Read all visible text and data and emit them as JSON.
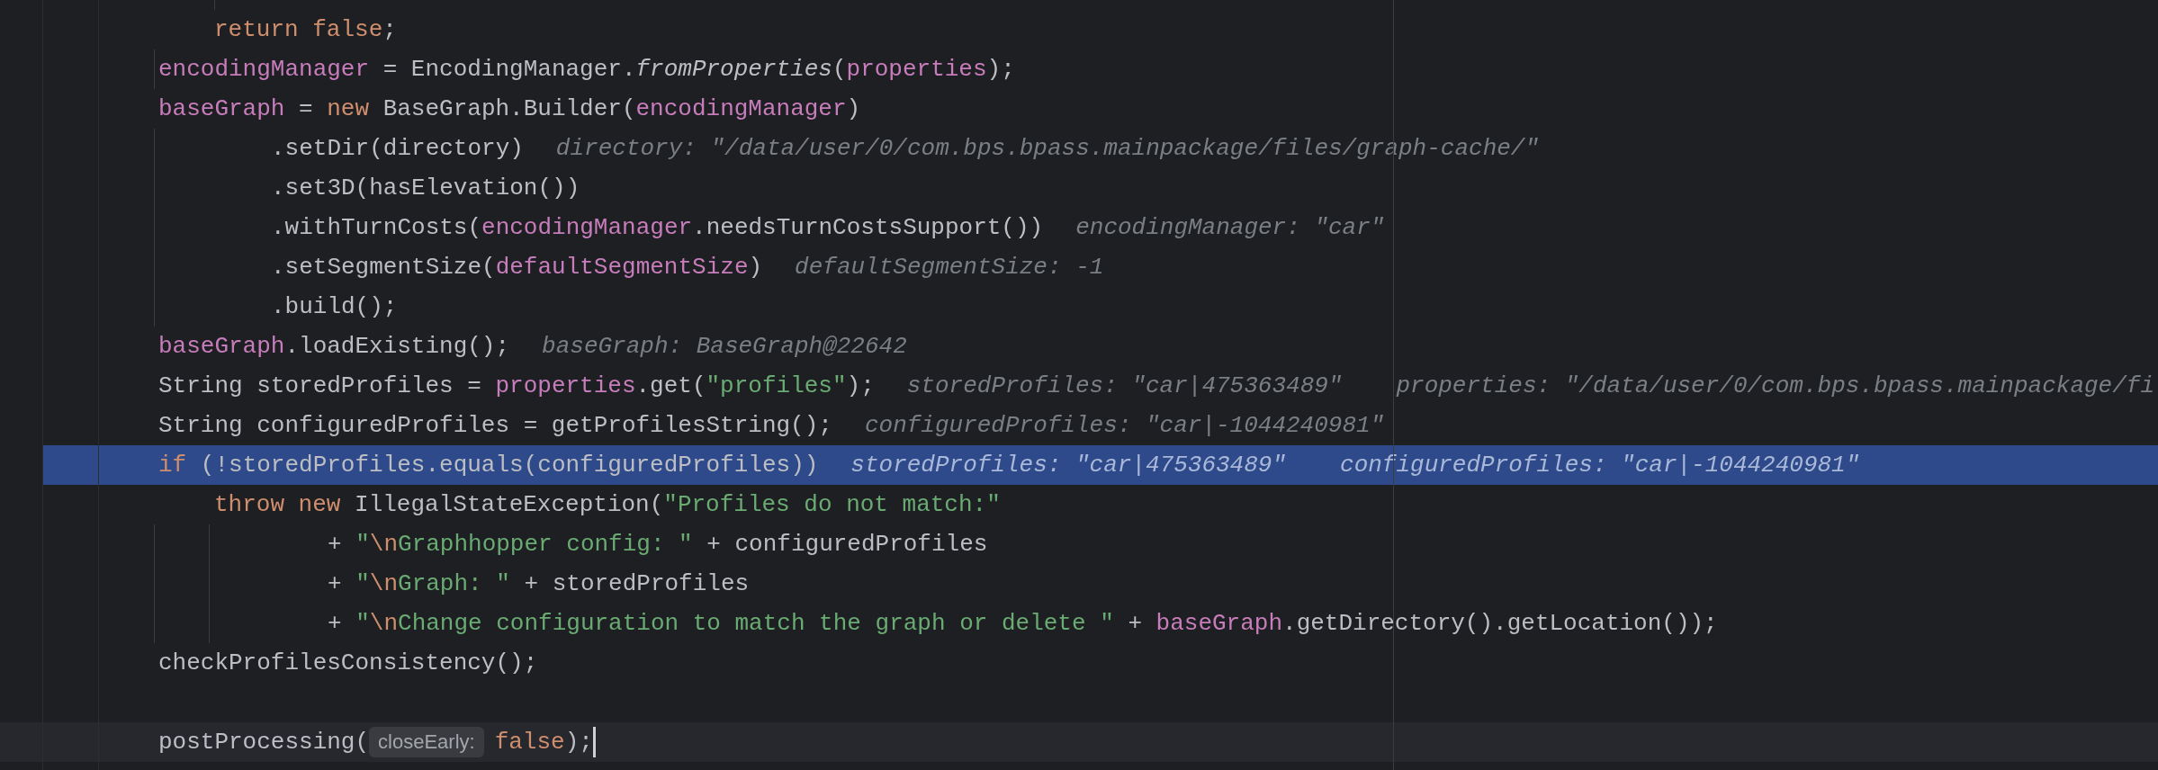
{
  "editor": {
    "lines": [
      {
        "kind": "inner",
        "highlighted": false,
        "caret": false,
        "tokens": [
          {
            "kind": "keyword",
            "text": "return "
          },
          {
            "kind": "keyword",
            "text": "false"
          },
          {
            "kind": "plain",
            "text": ";"
          }
        ]
      },
      {
        "kind": "block",
        "highlighted": false,
        "caret": false,
        "tokens": [
          {
            "kind": "field",
            "text": "encodingManager"
          },
          {
            "kind": "plain",
            "text": " = EncodingManager."
          },
          {
            "kind": "static",
            "text": "fromProperties"
          },
          {
            "kind": "plain",
            "text": "("
          },
          {
            "kind": "field",
            "text": "properties"
          },
          {
            "kind": "plain",
            "text": ");"
          }
        ]
      },
      {
        "kind": "block",
        "highlighted": false,
        "caret": false,
        "tokens": [
          {
            "kind": "field",
            "text": "baseGraph"
          },
          {
            "kind": "plain",
            "text": " = "
          },
          {
            "kind": "keyword",
            "text": "new"
          },
          {
            "kind": "plain",
            "text": " BaseGraph.Builder("
          },
          {
            "kind": "field",
            "text": "encodingManager"
          },
          {
            "kind": "plain",
            "text": ")"
          }
        ]
      },
      {
        "kind": "chained",
        "highlighted": false,
        "caret": false,
        "tokens": [
          {
            "kind": "plain",
            "text": ".setDir(directory)"
          }
        ],
        "hints": [
          "directory: \"/data/user/0/com.bps.bpass.mainpackage/files/graph-cache/\""
        ]
      },
      {
        "kind": "chained",
        "highlighted": false,
        "caret": false,
        "tokens": [
          {
            "kind": "plain",
            "text": ".set3D(hasElevation())"
          }
        ]
      },
      {
        "kind": "chained",
        "highlighted": false,
        "caret": false,
        "tokens": [
          {
            "kind": "plain",
            "text": ".withTurnCosts("
          },
          {
            "kind": "field",
            "text": "encodingManager"
          },
          {
            "kind": "plain",
            "text": ".needsTurnCostsSupport())"
          }
        ],
        "hints": [
          "encodingManager: \"car\""
        ]
      },
      {
        "kind": "chained",
        "highlighted": false,
        "caret": false,
        "tokens": [
          {
            "kind": "plain",
            "text": ".setSegmentSize("
          },
          {
            "kind": "field",
            "text": "defaultSegmentSize"
          },
          {
            "kind": "plain",
            "text": ")"
          }
        ],
        "hints": [
          "defaultSegmentSize: -1"
        ]
      },
      {
        "kind": "chained",
        "highlighted": false,
        "caret": false,
        "tokens": [
          {
            "kind": "plain",
            "text": ".build();"
          }
        ]
      },
      {
        "kind": "block",
        "highlighted": false,
        "caret": false,
        "tokens": [
          {
            "kind": "field",
            "text": "baseGraph"
          },
          {
            "kind": "plain",
            "text": ".loadExisting();"
          }
        ],
        "hints": [
          "baseGraph: BaseGraph@22642"
        ]
      },
      {
        "kind": "block",
        "highlighted": false,
        "caret": false,
        "tokens": [
          {
            "kind": "plain",
            "text": "String storedProfiles = "
          },
          {
            "kind": "field",
            "text": "properties"
          },
          {
            "kind": "plain",
            "text": ".get("
          },
          {
            "kind": "string",
            "text": "\"profiles\""
          },
          {
            "kind": "plain",
            "text": ");"
          }
        ],
        "hints": [
          "storedProfiles: \"car|475363489\"",
          "properties: \"/data/user/0/com.bps.bpass.mainpackage/fi"
        ]
      },
      {
        "kind": "block",
        "highlighted": false,
        "caret": false,
        "tokens": [
          {
            "kind": "plain",
            "text": "String configuredProfiles = getProfilesString();"
          }
        ],
        "hints": [
          "configuredProfiles: \"car|-1044240981\""
        ]
      },
      {
        "kind": "block",
        "highlighted": true,
        "caret": false,
        "tokens": [
          {
            "kind": "keyword",
            "text": "if"
          },
          {
            "kind": "plain",
            "text": " (!storedProfiles.equals(configuredProfiles))"
          }
        ],
        "hints": [
          "storedProfiles: \"car|475363489\"",
          "configuredProfiles: \"car|-1044240981\""
        ]
      },
      {
        "kind": "inner",
        "highlighted": false,
        "caret": false,
        "tokens": [
          {
            "kind": "keyword",
            "text": "throw new"
          },
          {
            "kind": "plain",
            "text": " IllegalStateException("
          },
          {
            "kind": "string",
            "text": "\"Profiles do not match:\""
          }
        ]
      },
      {
        "kind": "concat",
        "highlighted": false,
        "caret": false,
        "tokens": [
          {
            "kind": "plain",
            "text": "+ "
          },
          {
            "kind": "string",
            "text": "\""
          },
          {
            "kind": "escape",
            "text": "\\n"
          },
          {
            "kind": "string",
            "text": "Graphhopper config: \""
          },
          {
            "kind": "plain",
            "text": " + configuredProfiles"
          }
        ]
      },
      {
        "kind": "concat",
        "highlighted": false,
        "caret": false,
        "tokens": [
          {
            "kind": "plain",
            "text": "+ "
          },
          {
            "kind": "string",
            "text": "\""
          },
          {
            "kind": "escape",
            "text": "\\n"
          },
          {
            "kind": "string",
            "text": "Graph: \""
          },
          {
            "kind": "plain",
            "text": " + storedProfiles"
          }
        ]
      },
      {
        "kind": "concat",
        "highlighted": false,
        "caret": false,
        "tokens": [
          {
            "kind": "plain",
            "text": "+ "
          },
          {
            "kind": "string",
            "text": "\""
          },
          {
            "kind": "escape",
            "text": "\\n"
          },
          {
            "kind": "string",
            "text": "Change configuration to match the graph or delete \""
          },
          {
            "kind": "plain",
            "text": " + "
          },
          {
            "kind": "field",
            "text": "baseGraph"
          },
          {
            "kind": "plain",
            "text": ".getDirectory().getLocation());"
          }
        ]
      },
      {
        "kind": "block",
        "highlighted": false,
        "caret": false,
        "tokens": [
          {
            "kind": "plain",
            "text": "checkProfilesConsistency();"
          }
        ]
      },
      {
        "kind": "blank",
        "highlighted": false,
        "caret": false
      },
      {
        "kind": "block",
        "highlighted": false,
        "caret": true,
        "tokens": [
          {
            "kind": "plain",
            "text": "postProcessing("
          },
          {
            "kind": "param_hint",
            "text": "closeEarly:"
          },
          {
            "kind": "keyword",
            "text": "false"
          },
          {
            "kind": "plain",
            "text": ");"
          }
        ]
      }
    ]
  }
}
